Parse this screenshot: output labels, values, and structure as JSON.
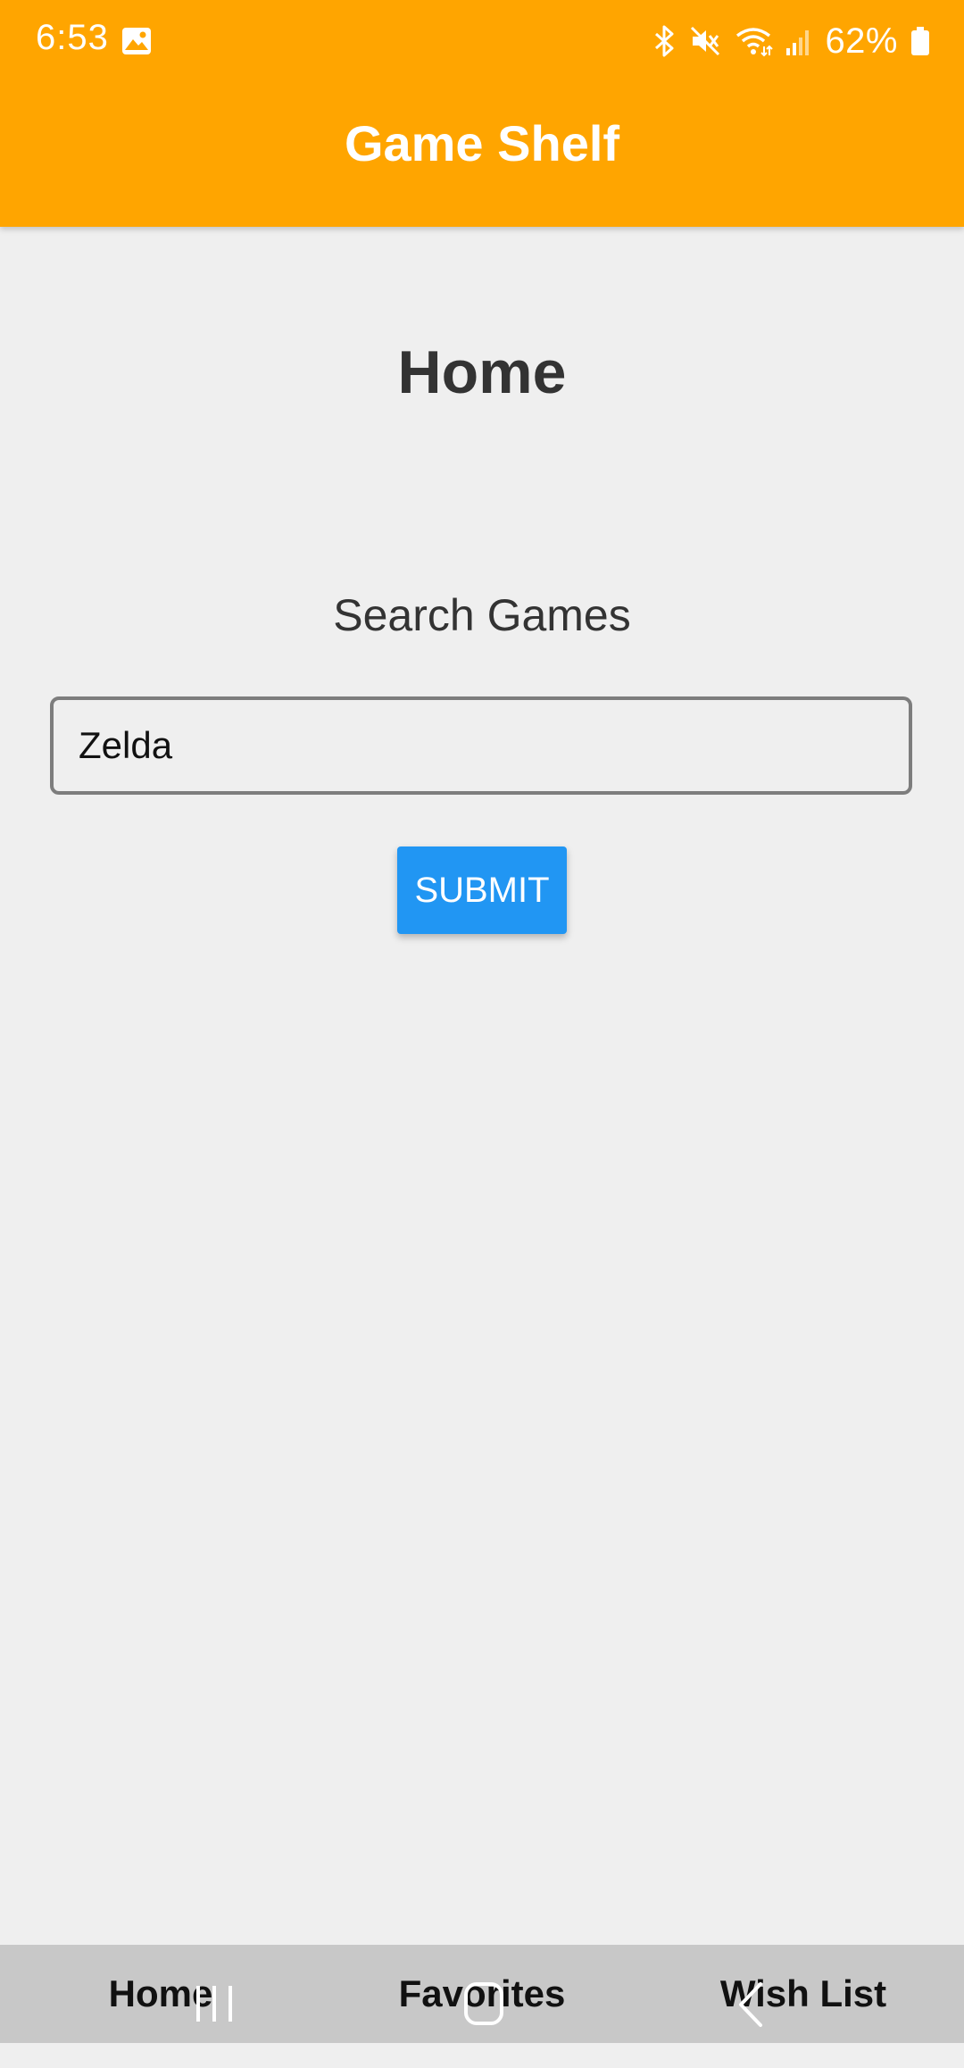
{
  "status_bar": {
    "time": "6:53",
    "battery": "62%",
    "icons": [
      "gallery-icon",
      "bluetooth-icon",
      "mute-icon",
      "wifi-icon",
      "signal-icon",
      "battery-icon"
    ]
  },
  "app_bar": {
    "title": "Game Shelf",
    "color": "#FFA500"
  },
  "main": {
    "heading": "Home",
    "search_label": "Search Games",
    "search_value": "Zelda",
    "submit_label": "SUBMIT",
    "submit_color": "#2196F3"
  },
  "tab_bar": {
    "tabs": [
      {
        "label": "Home"
      },
      {
        "label": "Favorites"
      },
      {
        "label": "Wish List"
      }
    ]
  },
  "system_nav": {
    "buttons": [
      "recents-icon",
      "home-icon",
      "back-icon"
    ]
  }
}
